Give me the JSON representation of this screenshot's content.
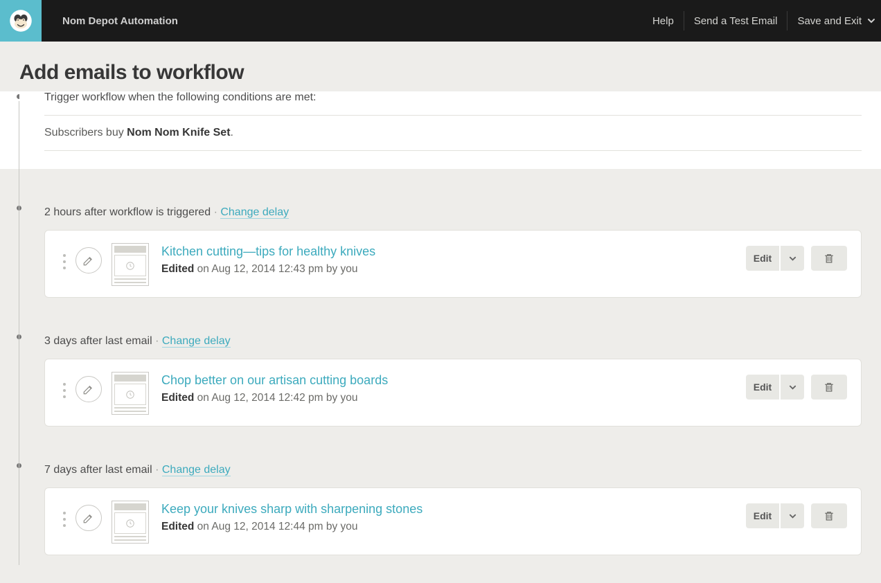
{
  "header": {
    "campaign_name": "Nom Depot Automation",
    "links": {
      "help": "Help",
      "send_test": "Send a Test Email",
      "save_exit": "Save and Exit"
    }
  },
  "page": {
    "title": "Add emails to workflow",
    "trigger_label": "Trigger workflow when the following conditions are met:",
    "trigger_text_prefix": "Subscribers buy ",
    "trigger_product": "Nom Nom Knife Set",
    "trigger_text_suffix": "."
  },
  "labels": {
    "change_delay": "Change delay",
    "edit": "Edit",
    "edited": "Edited"
  },
  "emails": [
    {
      "delay_text": "2 hours after workflow is triggered",
      "title": "Kitchen cutting—tips for healthy knives",
      "edited_text": " on Aug 12, 2014 12:43 pm by you"
    },
    {
      "delay_text": "3 days after last email",
      "title": "Chop better on our artisan cutting boards",
      "edited_text": " on Aug 12, 2014 12:42 pm by you"
    },
    {
      "delay_text": "7 days after last email",
      "title": "Keep your knives sharp with sharpening stones",
      "edited_text": " on Aug 12, 2014 12:44 pm by you"
    }
  ]
}
